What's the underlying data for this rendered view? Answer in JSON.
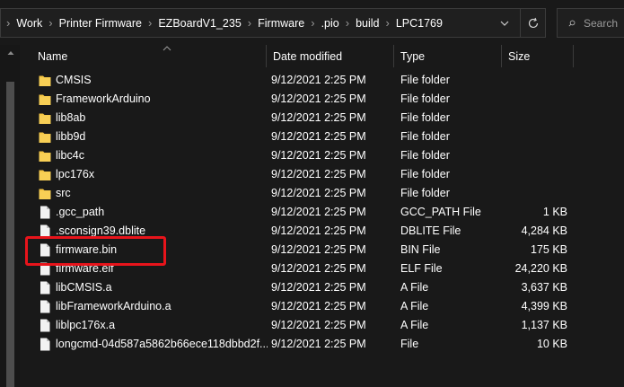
{
  "address_bar": {
    "crumbs": [
      "Work",
      "Printer Firmware",
      "EZBoardV1_235",
      "Firmware",
      ".pio",
      "build",
      "LPC1769"
    ]
  },
  "search": {
    "placeholder": "Search"
  },
  "columns": {
    "name": "Name",
    "date": "Date modified",
    "type": "Type",
    "size": "Size"
  },
  "files": [
    {
      "name": "CMSIS",
      "date": "9/12/2021 2:25 PM",
      "type": "File folder",
      "size": "",
      "kind": "folder-icon"
    },
    {
      "name": "FrameworkArduino",
      "date": "9/12/2021 2:25 PM",
      "type": "File folder",
      "size": "",
      "kind": "folder-icon"
    },
    {
      "name": "lib8ab",
      "date": "9/12/2021 2:25 PM",
      "type": "File folder",
      "size": "",
      "kind": "folder-icon"
    },
    {
      "name": "libb9d",
      "date": "9/12/2021 2:25 PM",
      "type": "File folder",
      "size": "",
      "kind": "folder-icon"
    },
    {
      "name": "libc4c",
      "date": "9/12/2021 2:25 PM",
      "type": "File folder",
      "size": "",
      "kind": "folder-icon"
    },
    {
      "name": "lpc176x",
      "date": "9/12/2021 2:25 PM",
      "type": "File folder",
      "size": "",
      "kind": "folder-icon"
    },
    {
      "name": "src",
      "date": "9/12/2021 2:25 PM",
      "type": "File folder",
      "size": "",
      "kind": "folder-icon"
    },
    {
      "name": ".gcc_path",
      "date": "9/12/2021 2:25 PM",
      "type": "GCC_PATH File",
      "size": "1 KB",
      "kind": "file-icon"
    },
    {
      "name": ".sconsign39.dblite",
      "date": "9/12/2021 2:25 PM",
      "type": "DBLITE File",
      "size": "4,284 KB",
      "kind": "file-icon"
    },
    {
      "name": "firmware.bin",
      "date": "9/12/2021 2:25 PM",
      "type": "BIN File",
      "size": "175 KB",
      "kind": "file-icon"
    },
    {
      "name": "firmware.elf",
      "date": "9/12/2021 2:25 PM",
      "type": "ELF File",
      "size": "24,220 KB",
      "kind": "file-icon"
    },
    {
      "name": "libCMSIS.a",
      "date": "9/12/2021 2:25 PM",
      "type": "A File",
      "size": "3,637 KB",
      "kind": "file-icon"
    },
    {
      "name": "libFrameworkArduino.a",
      "date": "9/12/2021 2:25 PM",
      "type": "A File",
      "size": "4,399 KB",
      "kind": "file-icon"
    },
    {
      "name": "liblpc176x.a",
      "date": "9/12/2021 2:25 PM",
      "type": "A File",
      "size": "1,137 KB",
      "kind": "file-icon"
    },
    {
      "name": "longcmd-04d587a5862b66ece118dbbd2f...",
      "date": "9/12/2021 2:25 PM",
      "type": "File",
      "size": "10 KB",
      "kind": "file-icon"
    }
  ],
  "highlight": {
    "target": "firmware.bin",
    "color": "#e8141b"
  },
  "colors": {
    "background": "#191919",
    "folder": "#f5c542",
    "file": "#f2f2f2",
    "highlight": "#e8141b"
  }
}
